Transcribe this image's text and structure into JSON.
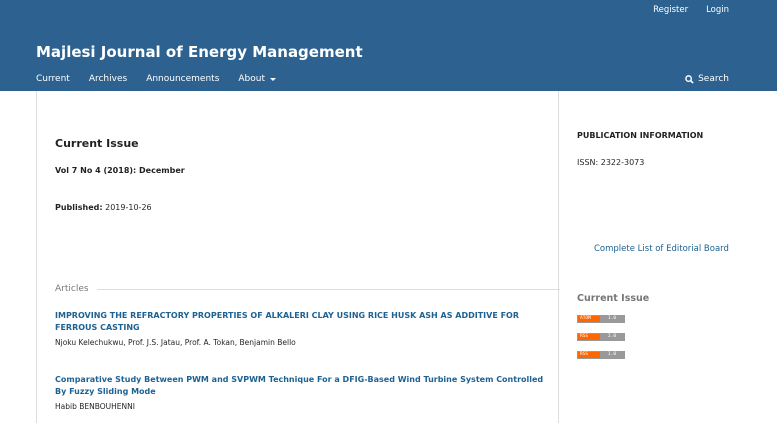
{
  "header": {
    "site_title": "Majlesi Journal of Energy Management",
    "user_nav": {
      "register": "Register",
      "login": "Login"
    },
    "nav": {
      "current": "Current",
      "archives": "Archives",
      "announcements": "Announcements",
      "about": "About"
    },
    "search_label": "Search",
    "color": "#2d6290"
  },
  "main": {
    "section_title": "Current Issue",
    "issue_title": "Vol 7 No 4 (2018): December",
    "published_label": "Published:",
    "published_date": "2019-10-26",
    "articles_heading": "Articles",
    "articles": [
      {
        "title": "IMPROVING THE REFRACTORY PROPERTIES OF ALKALERI CLAY USING RICE HUSK ASH AS ADDITIVE FOR FERROUS CASTING",
        "authors": "Njoku Kelechukwu, Prof. J.S. Jatau, Prof. A. Tokan, Benjamin Bello"
      },
      {
        "title": "Comparative Study Between PWM and SVPWM Technique For a DFIG-Based Wind Turbine System Controlled By Fuzzy Sliding Mode",
        "authors": "Habib BENBOUHENNI"
      }
    ],
    "link_color": "#1e6292"
  },
  "sidebar": {
    "publication_information": "PUBLICATION INFORMATION",
    "issn": "ISSN: 2322-3073",
    "editorial_board_link": "Complete List of Editorial Board",
    "current_issue_title": "Current Issue",
    "feeds": [
      {
        "left": "ATOM",
        "right": "1.0"
      },
      {
        "left": "RSS",
        "right": "2.0"
      },
      {
        "left": "RSS",
        "right": "1.0"
      }
    ]
  }
}
